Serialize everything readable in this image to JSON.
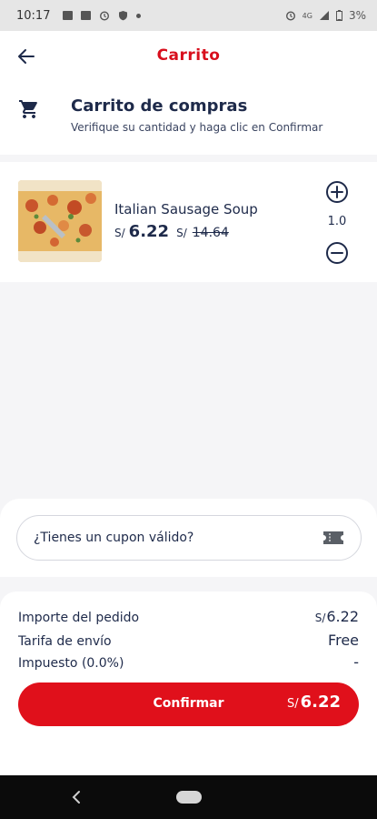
{
  "status_bar": {
    "time": "10:17",
    "signal_label": "4G",
    "battery": "3%"
  },
  "app_bar": {
    "title": "Carrito",
    "back_icon": "arrow-left-icon"
  },
  "cart_header": {
    "icon": "shopping-cart-icon",
    "title": "Carrito de compras",
    "subtitle": "Verifique su cantidad y haga clic en Confirmar"
  },
  "item": {
    "name": "Italian Sausage Soup",
    "currency": "S/",
    "price": "6.22",
    "old_currency": "S/",
    "old_price": "14.64",
    "quantity": "1.0"
  },
  "coupon": {
    "placeholder": "¿Tienes un cupon válido?",
    "icon": "ticket-icon"
  },
  "summary": {
    "order_label": "Importe del pedido",
    "order_currency": "S/",
    "order_value": "6.22",
    "shipping_label": "Tarifa de envío",
    "shipping_value": "Free",
    "tax_label": "Impuesto (0.0%)",
    "tax_value": "-"
  },
  "confirm": {
    "label": "Confirmar",
    "currency": "S/",
    "total": "6.22"
  },
  "colors": {
    "accent": "#d80f1d",
    "button": "#e0101b",
    "text": "#1e2a4a"
  }
}
